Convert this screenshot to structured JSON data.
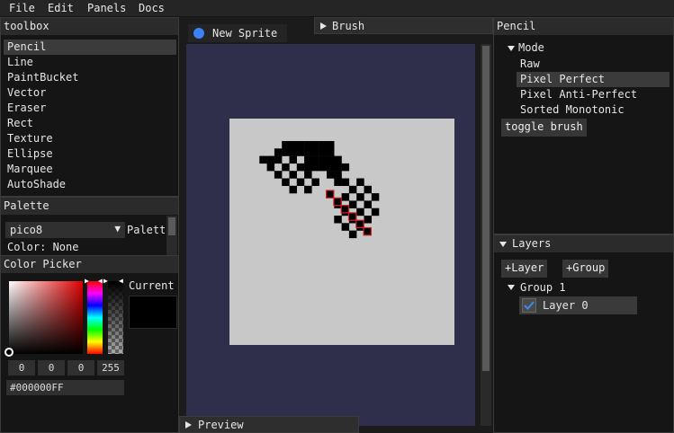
{
  "menubar": {
    "items": [
      "File",
      "Edit",
      "Panels",
      "Docs"
    ]
  },
  "toolbox": {
    "title": "toolbox",
    "tools": [
      "Pencil",
      "Line",
      "PaintBucket",
      "Vector",
      "Eraser",
      "Rect",
      "Texture",
      "Ellipse",
      "Marquee",
      "AutoShade"
    ],
    "selected_index": 0
  },
  "palette": {
    "title": "Palette",
    "selected": "pico8",
    "side_label": "Palett",
    "color_label": "Color: None"
  },
  "color_picker": {
    "title": "Color Picker",
    "current_label": "Current",
    "channels": [
      "0",
      "0",
      "0",
      "255"
    ],
    "hex": "#000000FF",
    "current_color": "#000000"
  },
  "document": {
    "tab_title": "New Sprite",
    "tab_dot_color": "#3b82f6",
    "brush_label": "Brush",
    "preview_label": "Preview",
    "canvas_bg": "#c8c8c8",
    "workspace_bg": "#2f2f4b"
  },
  "pencil_panel": {
    "title": "Pencil",
    "mode_label": "Mode",
    "modes": [
      "Raw",
      "Pixel Perfect",
      "Pixel Anti-Perfect",
      "Sorted Monotonic"
    ],
    "selected_mode_index": 1,
    "toggle_label": "toggle brush"
  },
  "layers_panel": {
    "title": "Layers",
    "add_layer_label": "+Layer",
    "add_group_label": "+Group",
    "group_name": "Group 1",
    "layer_name": "Layer 0",
    "layer_visible": true
  },
  "colors": {
    "accent": "#3b6fd6",
    "highlight_outline": "#d42020"
  }
}
